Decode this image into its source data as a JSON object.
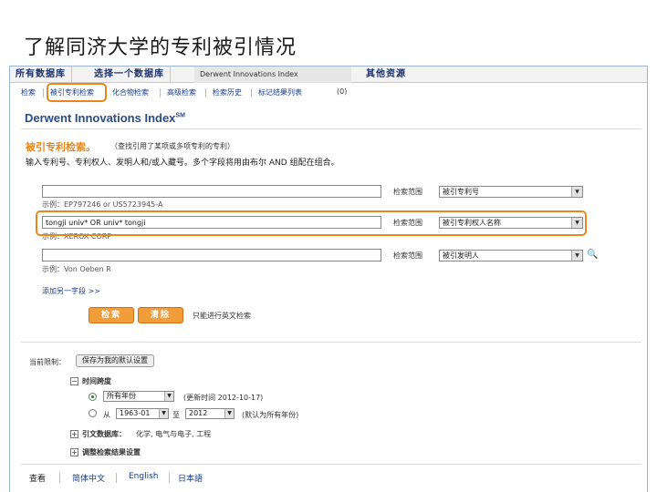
{
  "slide": {
    "title": "了解同济大学的专利被引情况"
  },
  "db_tabs": [
    {
      "label": "所有数据库"
    },
    {
      "label": "选择一个数据库"
    },
    {
      "label": "Derwent Innovations Index"
    },
    {
      "label": "其他资源"
    }
  ],
  "sub_nav": [
    {
      "label": "检索"
    },
    {
      "label": "被引专利检索"
    },
    {
      "label": "化合物检索"
    },
    {
      "label": "高级检索"
    },
    {
      "label": "检索历史"
    },
    {
      "label": "标记结果列表"
    },
    {
      "label": "(0)"
    }
  ],
  "product": {
    "title": "Derwent Innovations Index",
    "sup": "SM"
  },
  "search": {
    "title": "被引专利检索。",
    "note": "（查找引用了某项或多项专利的专利）",
    "instructions": "输入专利号、专利权人、发明人和/或入藏号。多个字段将用由布尔 AND 组配在组合。",
    "label_field": "检索范围",
    "rows": [
      {
        "value": "",
        "example": "示例：EP797246 or US5723945-A",
        "select": "被引专利号"
      },
      {
        "value": "tongji univ* OR univ* tongji",
        "example": "示例：XEROX CORP",
        "select": "被引专利权人名称"
      },
      {
        "value": "",
        "example": "示例：Von Oeben R",
        "select": "被引发明人"
      }
    ],
    "add_row": "添加另一字段 >>",
    "search_button": "检索",
    "clear_button": "清除",
    "only_cited": "只能进行英文检索"
  },
  "limits": {
    "label": "当前限制：",
    "save_button": "保存为我的默认设置",
    "timespan_label": "时间跨度",
    "timespan_select": "所有年份",
    "timespan_update": "(更新时间 2012-10-17)",
    "from_label": "从",
    "from_value": "1963-01",
    "to_label": "至",
    "to_value": "2012",
    "default_note": "(默认为所有年份)",
    "citation_db_label": "引文数据库：",
    "citation_db_value": "化学, 电气与电子, 工程",
    "adjust_label": "调整检索结果设置"
  },
  "footer": [
    {
      "label": "查看"
    },
    {
      "label": "简体中文"
    },
    {
      "label": "English"
    },
    {
      "label": "日本語"
    }
  ],
  "colors": {
    "accent": "#e8871e",
    "brand": "#2b4c8c",
    "link": "#1a3c8a"
  },
  "icons": [
    "magnifier-icon",
    "tree-collapse-icon",
    "tree-expand-icon",
    "dropdown-arrow-icon"
  ]
}
